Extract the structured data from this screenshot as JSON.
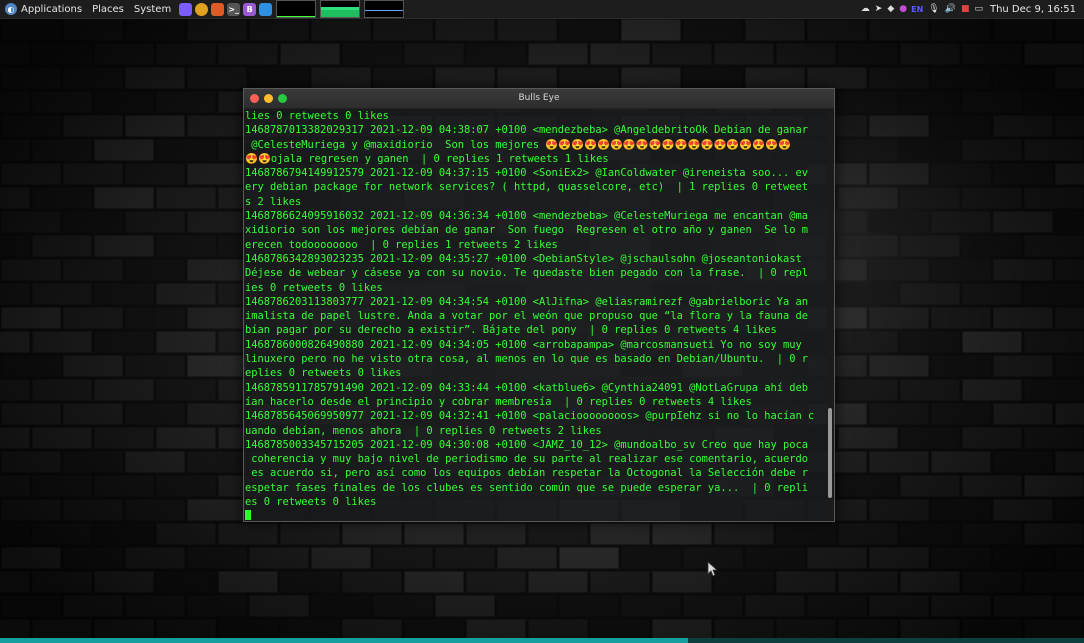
{
  "top_panel": {
    "menus": [
      "Applications",
      "Places",
      "System"
    ],
    "launchers": [
      {
        "icon": "app-icon-violet",
        "color": "#7b5cff",
        "glyph": ""
      },
      {
        "icon": "chrome-icon",
        "color": "#e0a020",
        "glyph": ""
      },
      {
        "icon": "brave-icon",
        "color": "#e05a28",
        "glyph": ""
      },
      {
        "icon": "terminal-icon",
        "color": "#555555",
        "glyph": ">_"
      },
      {
        "icon": "app-icon-b",
        "color": "#9b59d0",
        "glyph": "B"
      },
      {
        "icon": "window-icon",
        "color": "#2f8fe0",
        "glyph": ""
      }
    ],
    "clock": "Thu Dec  9, 16:51",
    "lang": "EN"
  },
  "window": {
    "title": "Bulls Eye",
    "scroll_position": 0.93
  },
  "terminal_lines": [
    "lies 0 retweets 0 likes",
    "1468787013382029317 2021-12-09 04:38:07 +0100 <mendezbeba> @AngeldebritoOk Debían de ganar",
    " @CelesteMuriega y @maxidiorio  Son los mejores 😍😍😍😍😍😍😍😍😍😍😍😍😍😍😍😍😍😍😍",
    "😍😍ojala regresen y ganen  | 0 replies 1 retweets 1 likes",
    "1468786794149912579 2021-12-09 04:37:15 +0100 <SoniEx2> @IanColdwater @ireneista soo... ev",
    "ery debian package for network services? ( httpd, quasselcore, etc)  | 1 replies 0 retweet",
    "s 2 likes",
    "1468786624095916032 2021-12-09 04:36:34 +0100 <mendezbeba> @CelesteMuriega me encantan @ma",
    "xidiorio son los mejores debían de ganar  Son fuego  Regresen el otro año y ganen  Se lo m",
    "erecen todoooooooo  | 0 replies 1 retweets 2 likes",
    "1468786342893023235 2021-12-09 04:35:27 +0100 <DebianStyle> @jschaulsohn @joseantoniokast",
    "Déjese de webear y cásese ya con su novio. Te quedaste bien pegado con la frase.  | 0 repl",
    "ies 0 retweets 0 likes",
    "1468786203113803777 2021-12-09 04:34:54 +0100 <AlJifna> @eliasramirezf @gabrielboric Ya an",
    "imalista de papel lustre. Anda a votar por el weón que propuso que “la flora y la fauna de",
    "bían pagar por su derecho a existir”. Bájate del pony  | 0 replies 0 retweets 4 likes",
    "1468786000826490880 2021-12-09 04:34:05 +0100 <arrobapampa> @marcosmansueti Yo no soy muy",
    "linuxero pero no he visto otra cosa, al menos en lo que es basado en Debian/Ubuntu.  | 0 r",
    "eplies 0 retweets 0 likes",
    "1468785911785791490 2021-12-09 04:33:44 +0100 <katblue6> @Cynthia24091 @NotLaGrupa ahí deb",
    "ían hacerlo desde el principio y cobrar membresía  | 0 replies 0 retweets 4 likes",
    "1468785645069950977 2021-12-09 04:32:41 +0100 <palacioooooooos> @purpIehz si no lo hacían c",
    "uando debían, menos ahora  | 0 replies 0 retweets 2 likes",
    "1468785003345715205 2021-12-09 04:30:08 +0100 <JAMZ_10_12> @mundoalbo_sv Creo que hay poca",
    " coherencia y muy bajo nivel de periodismo de su parte al realizar ese comentario, acuerdo",
    " es acuerdo si, pero así como los equipos debían respetar la Octogonal la Selección debe r",
    "espetar fases finales de los clubes es sentido común que se puede esperar ya...  | 0 repli",
    "es 0 retweets 0 likes"
  ],
  "colors": {
    "terminal_text": "#35ff35",
    "panel_bg": "#1d1d1d",
    "close": "#ff5f56",
    "minimize": "#ffbd2e",
    "maximize": "#27c93f"
  }
}
